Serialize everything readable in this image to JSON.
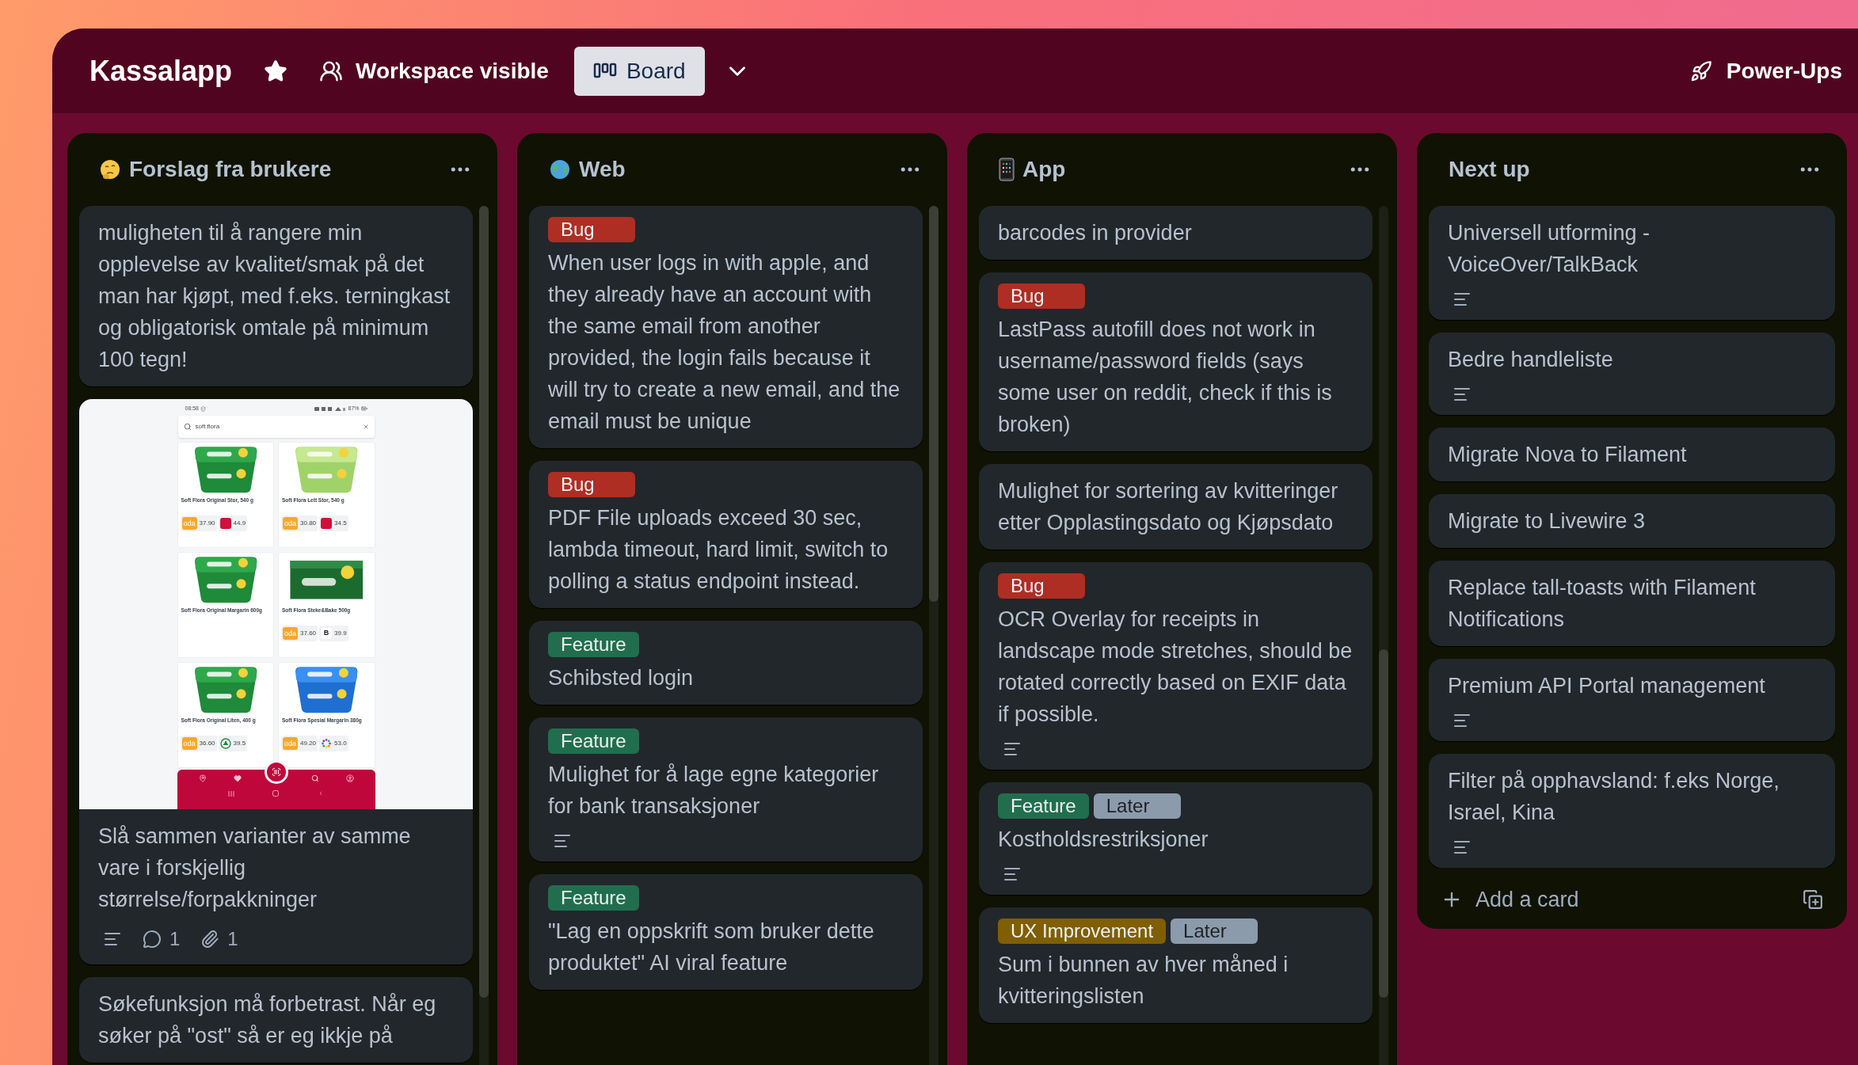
{
  "header": {
    "title": "Kassalapp",
    "visibility": "Workspace visible",
    "view": "Board",
    "power_ups": "Power-Ups"
  },
  "lists": [
    {
      "title": "Forslag fra brukere",
      "cards": [
        {
          "kind": "text",
          "title": "muligheten til å rangere min opplevelse av kvalitet/smak på det man har kjøpt, med f.eks. terningkast og obligatorisk omtale på minimum 100 tegn!"
        },
        {
          "kind": "cover",
          "title": "Slå sammen varianter av samme vare i forskjellig størrelse/forpakkninger",
          "badges": {
            "description": true,
            "comments": "1",
            "attachments": "1"
          },
          "cover": {
            "time": "08:58",
            "battery": "87%",
            "search": "soft flora",
            "products": [
              {
                "name": "Soft Flora Original Stor, 540 g",
                "prices": [
                  {
                    "kind": "text",
                    "logo": "oda",
                    "price": "37.90"
                  },
                  {
                    "kind": "square",
                    "price": "44.9"
                  }
                ]
              },
              {
                "name": "Soft Flora Lett Stor, 540 g",
                "prices": [
                  {
                    "kind": "text",
                    "logo": "oda",
                    "price": "30.80"
                  },
                  {
                    "kind": "square",
                    "price": "34.5"
                  }
                ]
              },
              {
                "name": "Soft Flora Original Margarin 600g"
              },
              {
                "name": "Soft Flora Steke&Bake 500g",
                "prices": [
                  {
                    "kind": "text",
                    "logo": "oda",
                    "price": "37.60"
                  },
                  {
                    "kind": "letter",
                    "logo": "B",
                    "price": "39.9"
                  }
                ]
              },
              {
                "name": "Soft Flora Original Liten, 400 g",
                "prices": [
                  {
                    "kind": "text",
                    "logo": "oda",
                    "price": "36.60"
                  },
                  {
                    "kind": "tree",
                    "price": "39.5"
                  }
                ]
              },
              {
                "name": "Soft Flora Spesial Margarin 380g",
                "prices": [
                  {
                    "kind": "text",
                    "logo": "oda",
                    "price": "49.20"
                  },
                  {
                    "kind": "ring",
                    "price": "53.0"
                  }
                ]
              }
            ]
          }
        },
        {
          "kind": "text",
          "title": "Søkefunksjon må forbetrast. Når eg søker på \"ost\" så er eg ikkje på"
        }
      ]
    },
    {
      "title": "Web",
      "cards": [
        {
          "kind": "text",
          "labels": [
            {
              "text": "Bug",
              "color": "#ae2e24"
            }
          ],
          "title": "When user logs in with apple, and they already have an account with the same email from another provided, the login fails because it will try to create a new email, and the email must be unique"
        },
        {
          "kind": "text",
          "labels": [
            {
              "text": "Bug",
              "color": "#ae2e24"
            }
          ],
          "title": "PDF File uploads exceed 30 sec, lambda timeout, hard limit, switch to polling a status endpoint instead."
        },
        {
          "kind": "text",
          "labels": [
            {
              "text": "Feature",
              "color": "#216e4e"
            }
          ],
          "title": "Schibsted login"
        },
        {
          "kind": "text",
          "labels": [
            {
              "text": "Feature",
              "color": "#216e4e"
            }
          ],
          "title": "Mulighet for å lage egne kategorier for bank transaksjoner",
          "badges": {
            "description": true
          }
        },
        {
          "kind": "text",
          "labels": [
            {
              "text": "Feature",
              "color": "#216e4e"
            }
          ],
          "title": "\"Lag en oppskrift som bruker dette produktet\" AI viral feature"
        }
      ]
    },
    {
      "title": "App",
      "cards": [
        {
          "kind": "text",
          "title": "barcodes in provider"
        },
        {
          "kind": "text",
          "labels": [
            {
              "text": "Bug",
              "color": "#ae2e24"
            }
          ],
          "title": "LastPass autofill does not work in username/password fields (says some user on reddit, check if this is broken)"
        },
        {
          "kind": "text",
          "title": "Mulighet for sortering av kvitteringer etter Opplastingsdato og Kjøpsdato"
        },
        {
          "kind": "text",
          "labels": [
            {
              "text": "Bug",
              "color": "#ae2e24"
            }
          ],
          "title": "OCR Overlay for receipts in landscape mode stretches, should be rotated correctly based on EXIF data if possible.",
          "badges": {
            "description": true
          }
        },
        {
          "kind": "text",
          "labels": [
            {
              "text": "Feature",
              "color": "#216e4e"
            },
            {
              "text": "Later",
              "color": "#8c9bab"
            }
          ],
          "title": "Kostholdsrestriksjoner",
          "badges": {
            "description": true
          }
        },
        {
          "kind": "text",
          "labels": [
            {
              "text": "UX Improvement",
              "color": "#7f5f01"
            },
            {
              "text": "Later",
              "color": "#8c9bab"
            }
          ],
          "title": "Sum i bunnen av hver måned i kvitteringslisten"
        }
      ]
    },
    {
      "title": "Next up",
      "add_card": "Add a card",
      "cards": [
        {
          "kind": "text",
          "title": "Universell utforming - VoiceOver/TalkBack",
          "badges": {
            "description": true
          }
        },
        {
          "kind": "text",
          "title": "Bedre handleliste",
          "badges": {
            "description": true
          }
        },
        {
          "kind": "text",
          "title": "Migrate Nova to Filament"
        },
        {
          "kind": "text",
          "title": "Migrate to Livewire 3"
        },
        {
          "kind": "text",
          "title": "Replace tall-toasts with Filament Notifications"
        },
        {
          "kind": "text",
          "title": "Premium API Portal management",
          "badges": {
            "description": true
          }
        },
        {
          "kind": "text",
          "title": "Filter på opphavsland: f.eks Norge, Israel, Kina",
          "badges": {
            "description": true
          }
        }
      ]
    }
  ]
}
